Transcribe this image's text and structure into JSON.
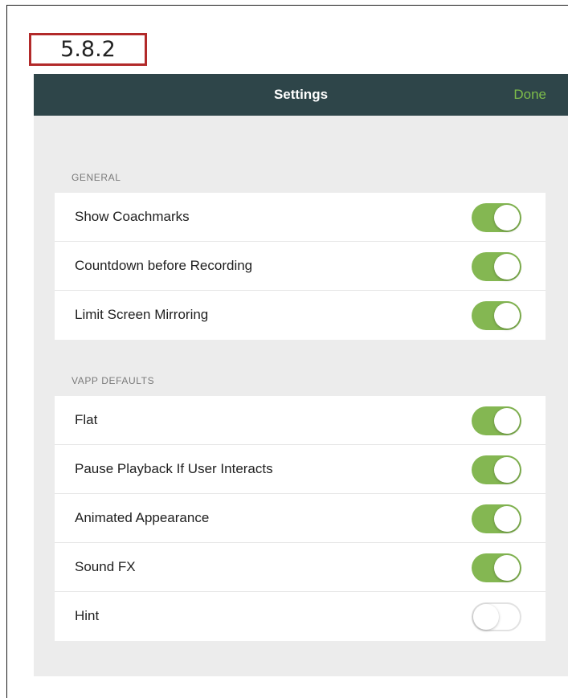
{
  "version_label": "5.8.2",
  "navbar": {
    "title": "Settings",
    "done_label": "Done"
  },
  "colors": {
    "navbar_bg": "#2e4549",
    "accent": "#84b752",
    "done_text": "#7ebd4a",
    "panel_bg": "#ececec",
    "label_border": "#b22a2a"
  },
  "sections": [
    {
      "header": "GENERAL",
      "rows": [
        {
          "label": "Show Coachmarks",
          "toggle_on": true
        },
        {
          "label": "Countdown before Recording",
          "toggle_on": true
        },
        {
          "label": "Limit Screen Mirroring",
          "toggle_on": true
        }
      ]
    },
    {
      "header": "VAPP DEFAULTS",
      "rows": [
        {
          "label": "Flat",
          "toggle_on": true
        },
        {
          "label": "Pause Playback If User Interacts",
          "toggle_on": true
        },
        {
          "label": "Animated Appearance",
          "toggle_on": true
        },
        {
          "label": "Sound FX",
          "toggle_on": true
        },
        {
          "label": "Hint",
          "toggle_on": false
        }
      ]
    }
  ]
}
